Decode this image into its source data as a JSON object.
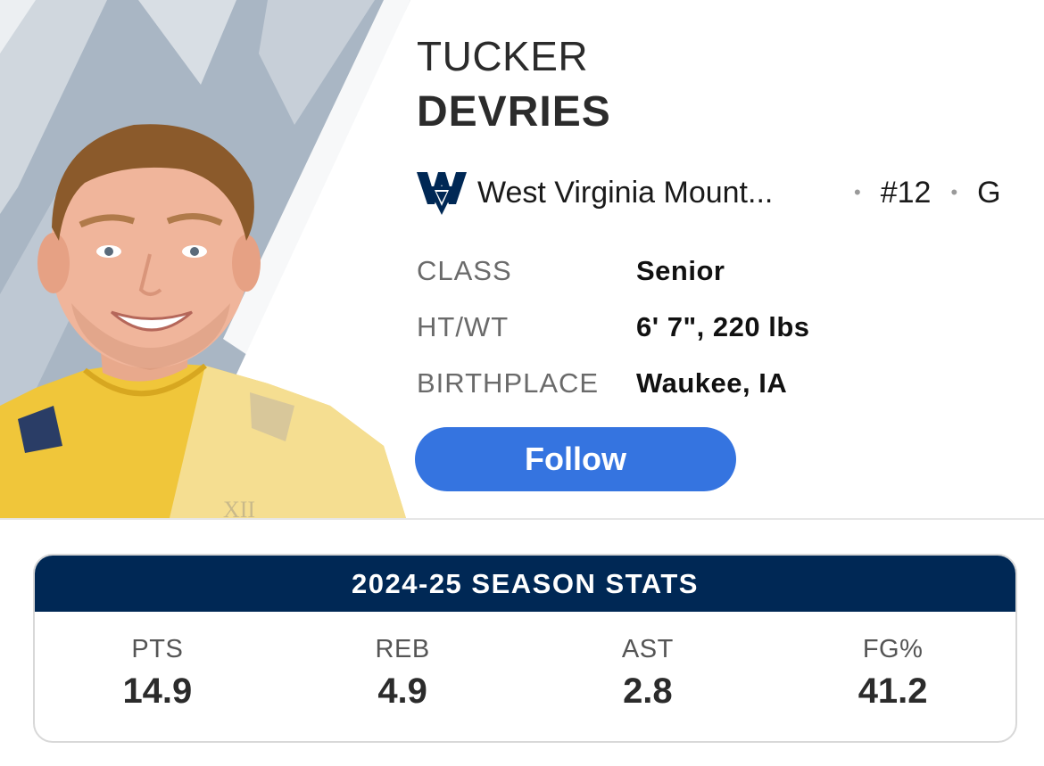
{
  "player": {
    "first_name": "TUCKER",
    "last_name": "DEVRIES",
    "team_name": "West Virginia Mount...",
    "number": "#12",
    "position": "G",
    "separator": "•"
  },
  "info": [
    {
      "label": "CLASS",
      "value": "Senior"
    },
    {
      "label": "HT/WT",
      "value": "6' 7\", 220 lbs"
    },
    {
      "label": "BIRTHPLACE",
      "value": "Waukee, IA"
    }
  ],
  "follow_button": {
    "label": "Follow"
  },
  "photo": {
    "jersey_mark": "XII"
  },
  "stats": {
    "title": "2024-25 SEASON STATS",
    "items": [
      {
        "label": "PTS",
        "value": "14.9"
      },
      {
        "label": "REB",
        "value": "4.9"
      },
      {
        "label": "AST",
        "value": "2.8"
      },
      {
        "label": "FG%",
        "value": "41.2"
      }
    ]
  },
  "colors": {
    "team_navy": "#002855",
    "team_gold": "#EAAA00",
    "follow_blue": "#3574E0",
    "panel_gray": "#A9B6C4"
  },
  "icons": {
    "team_logo": "flying-wv-logo-icon"
  }
}
